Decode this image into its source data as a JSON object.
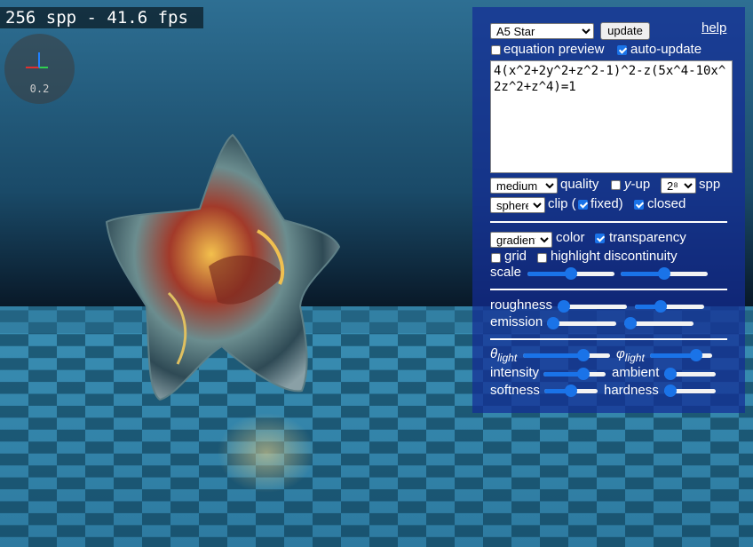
{
  "overlay": {
    "fps_text": "256 spp - 41.6 fps",
    "axis_scale": "0.2",
    "axis_colors": {
      "x": "#2080ff",
      "y": "#30d050",
      "z": "#e03030",
      "up": "#4070ff"
    }
  },
  "panel": {
    "shape_select": {
      "value": "A5 Star",
      "options": [
        "A5 Star"
      ]
    },
    "update_label": "update",
    "help_label": "help",
    "equation_preview": {
      "label": "equation preview",
      "checked": false
    },
    "auto_update": {
      "label": "auto-update",
      "checked": true
    },
    "equation": "4(x^2+2y^2+z^2-1)^2-z(5x^4-10x^2z^2+z^4)=1",
    "quality_select": {
      "value": "medium",
      "options": [
        "medium"
      ]
    },
    "quality_label": "quality",
    "y_up": {
      "label_italic": "y",
      "label_rest": "-up",
      "checked": false
    },
    "spp_select": {
      "value": "2⁸",
      "options": [
        "2⁸"
      ]
    },
    "spp_label": "spp",
    "clip_select": {
      "value": "sphere",
      "options": [
        "sphere"
      ]
    },
    "clip_label": "clip (",
    "fixed": {
      "label": "fixed)",
      "checked": true
    },
    "closed": {
      "label": "closed",
      "checked": true
    },
    "color_select": {
      "value": "gradient",
      "options": [
        "gradient"
      ]
    },
    "color_label": "color",
    "transparency": {
      "label": "transparency",
      "checked": true
    },
    "grid": {
      "label": "grid",
      "checked": false
    },
    "highlight_discontinuity": {
      "label": "highlight discontinuity",
      "checked": false
    },
    "scale_label": "scale",
    "scale_slider_1": 0.5,
    "scale_slider_2": 0.5,
    "roughness_label": "roughness",
    "roughness_slider_1": 0.0,
    "roughness_slider_2": 0.35,
    "emission_label": "emission",
    "emission_slider_1": 0.0,
    "emission_slider_2": 0.0,
    "theta_symbol": "θ",
    "phi_symbol": "φ",
    "light_sub": "light",
    "theta_light": 0.73,
    "phi_light": 0.8,
    "intensity_label": "intensity",
    "intensity_slider": 0.68,
    "ambient_label": "ambient",
    "ambient_slider": 0.0,
    "softness_label": "softness",
    "softness_slider": 0.5,
    "hardness_label": "hardness",
    "hardness_slider": 0.0
  }
}
